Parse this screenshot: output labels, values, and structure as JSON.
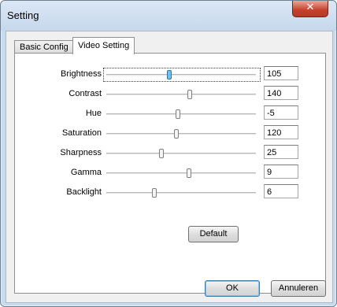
{
  "window": {
    "title": "Setting",
    "close_glyph": "✕"
  },
  "tabs": [
    {
      "label": "Basic Config",
      "active": false
    },
    {
      "label": "Video Setting",
      "active": true
    }
  ],
  "settings": [
    {
      "label": "Brightness",
      "value": "105",
      "level": 0.42,
      "focused": true
    },
    {
      "label": "Contrast",
      "value": "140",
      "level": 0.56
    },
    {
      "label": "Hue",
      "value": "-5",
      "level": 0.48
    },
    {
      "label": "Saturation",
      "value": "120",
      "level": 0.47
    },
    {
      "label": "Sharpness",
      "value": "25",
      "level": 0.37
    },
    {
      "label": "Gamma",
      "value": "9",
      "level": 0.55
    },
    {
      "label": "Backlight",
      "value": "6",
      "level": 0.32
    }
  ],
  "buttons": {
    "default": "Default",
    "ok": "OK",
    "cancel": "Annuleren"
  },
  "colors": {
    "accent_thumb": "#6fc1e8",
    "close_button": "#c6402b",
    "frame": "#c9daee"
  }
}
